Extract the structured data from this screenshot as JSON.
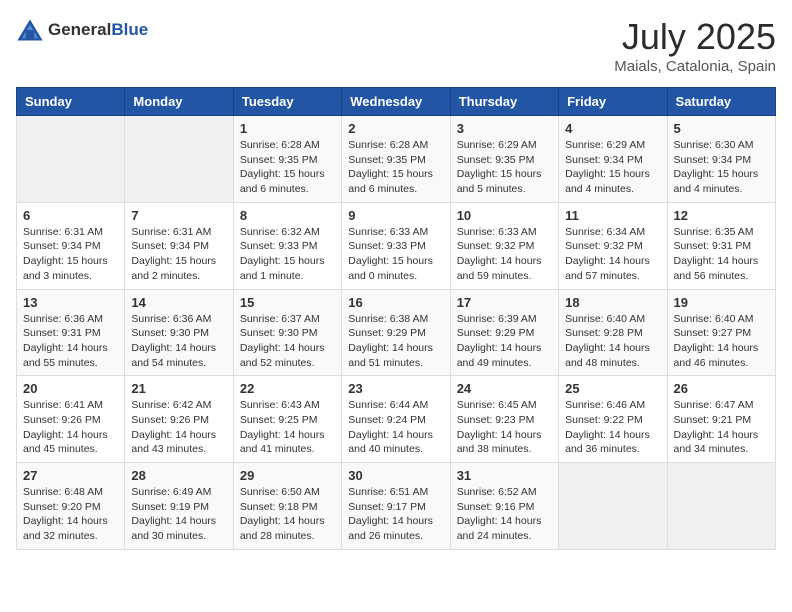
{
  "logo": {
    "general": "General",
    "blue": "Blue"
  },
  "header": {
    "month": "July 2025",
    "location": "Maials, Catalonia, Spain"
  },
  "weekdays": [
    "Sunday",
    "Monday",
    "Tuesday",
    "Wednesday",
    "Thursday",
    "Friday",
    "Saturday"
  ],
  "weeks": [
    [
      {
        "day": "",
        "content": ""
      },
      {
        "day": "",
        "content": ""
      },
      {
        "day": "1",
        "content": "Sunrise: 6:28 AM\nSunset: 9:35 PM\nDaylight: 15 hours and 6 minutes."
      },
      {
        "day": "2",
        "content": "Sunrise: 6:28 AM\nSunset: 9:35 PM\nDaylight: 15 hours and 6 minutes."
      },
      {
        "day": "3",
        "content": "Sunrise: 6:29 AM\nSunset: 9:35 PM\nDaylight: 15 hours and 5 minutes."
      },
      {
        "day": "4",
        "content": "Sunrise: 6:29 AM\nSunset: 9:34 PM\nDaylight: 15 hours and 4 minutes."
      },
      {
        "day": "5",
        "content": "Sunrise: 6:30 AM\nSunset: 9:34 PM\nDaylight: 15 hours and 4 minutes."
      }
    ],
    [
      {
        "day": "6",
        "content": "Sunrise: 6:31 AM\nSunset: 9:34 PM\nDaylight: 15 hours and 3 minutes."
      },
      {
        "day": "7",
        "content": "Sunrise: 6:31 AM\nSunset: 9:34 PM\nDaylight: 15 hours and 2 minutes."
      },
      {
        "day": "8",
        "content": "Sunrise: 6:32 AM\nSunset: 9:33 PM\nDaylight: 15 hours and 1 minute."
      },
      {
        "day": "9",
        "content": "Sunrise: 6:33 AM\nSunset: 9:33 PM\nDaylight: 15 hours and 0 minutes."
      },
      {
        "day": "10",
        "content": "Sunrise: 6:33 AM\nSunset: 9:32 PM\nDaylight: 14 hours and 59 minutes."
      },
      {
        "day": "11",
        "content": "Sunrise: 6:34 AM\nSunset: 9:32 PM\nDaylight: 14 hours and 57 minutes."
      },
      {
        "day": "12",
        "content": "Sunrise: 6:35 AM\nSunset: 9:31 PM\nDaylight: 14 hours and 56 minutes."
      }
    ],
    [
      {
        "day": "13",
        "content": "Sunrise: 6:36 AM\nSunset: 9:31 PM\nDaylight: 14 hours and 55 minutes."
      },
      {
        "day": "14",
        "content": "Sunrise: 6:36 AM\nSunset: 9:30 PM\nDaylight: 14 hours and 54 minutes."
      },
      {
        "day": "15",
        "content": "Sunrise: 6:37 AM\nSunset: 9:30 PM\nDaylight: 14 hours and 52 minutes."
      },
      {
        "day": "16",
        "content": "Sunrise: 6:38 AM\nSunset: 9:29 PM\nDaylight: 14 hours and 51 minutes."
      },
      {
        "day": "17",
        "content": "Sunrise: 6:39 AM\nSunset: 9:29 PM\nDaylight: 14 hours and 49 minutes."
      },
      {
        "day": "18",
        "content": "Sunrise: 6:40 AM\nSunset: 9:28 PM\nDaylight: 14 hours and 48 minutes."
      },
      {
        "day": "19",
        "content": "Sunrise: 6:40 AM\nSunset: 9:27 PM\nDaylight: 14 hours and 46 minutes."
      }
    ],
    [
      {
        "day": "20",
        "content": "Sunrise: 6:41 AM\nSunset: 9:26 PM\nDaylight: 14 hours and 45 minutes."
      },
      {
        "day": "21",
        "content": "Sunrise: 6:42 AM\nSunset: 9:26 PM\nDaylight: 14 hours and 43 minutes."
      },
      {
        "day": "22",
        "content": "Sunrise: 6:43 AM\nSunset: 9:25 PM\nDaylight: 14 hours and 41 minutes."
      },
      {
        "day": "23",
        "content": "Sunrise: 6:44 AM\nSunset: 9:24 PM\nDaylight: 14 hours and 40 minutes."
      },
      {
        "day": "24",
        "content": "Sunrise: 6:45 AM\nSunset: 9:23 PM\nDaylight: 14 hours and 38 minutes."
      },
      {
        "day": "25",
        "content": "Sunrise: 6:46 AM\nSunset: 9:22 PM\nDaylight: 14 hours and 36 minutes."
      },
      {
        "day": "26",
        "content": "Sunrise: 6:47 AM\nSunset: 9:21 PM\nDaylight: 14 hours and 34 minutes."
      }
    ],
    [
      {
        "day": "27",
        "content": "Sunrise: 6:48 AM\nSunset: 9:20 PM\nDaylight: 14 hours and 32 minutes."
      },
      {
        "day": "28",
        "content": "Sunrise: 6:49 AM\nSunset: 9:19 PM\nDaylight: 14 hours and 30 minutes."
      },
      {
        "day": "29",
        "content": "Sunrise: 6:50 AM\nSunset: 9:18 PM\nDaylight: 14 hours and 28 minutes."
      },
      {
        "day": "30",
        "content": "Sunrise: 6:51 AM\nSunset: 9:17 PM\nDaylight: 14 hours and 26 minutes."
      },
      {
        "day": "31",
        "content": "Sunrise: 6:52 AM\nSunset: 9:16 PM\nDaylight: 14 hours and 24 minutes."
      },
      {
        "day": "",
        "content": ""
      },
      {
        "day": "",
        "content": ""
      }
    ]
  ]
}
